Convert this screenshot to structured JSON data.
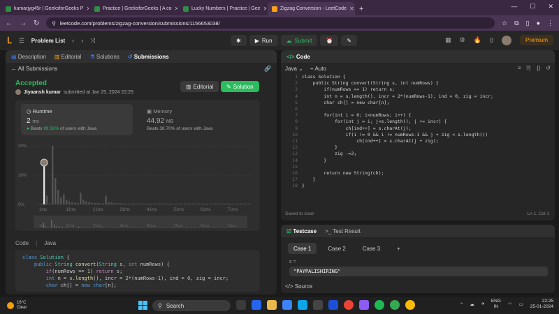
{
  "browser": {
    "tabs": [
      {
        "title": "kumarjyg45r | GeeksforGeeks P",
        "active": false
      },
      {
        "title": "Practice | GeeksforGeeks | A co",
        "active": false
      },
      {
        "title": "Lucky Numbers | Practice | Gee",
        "active": false
      },
      {
        "title": "Zigzag Conversion - LeetCode",
        "active": true
      }
    ],
    "url": "leetcode.com/problems/zigzag-conversion/submissions/1156653038/"
  },
  "header": {
    "problem_list": "Problem List",
    "run": "Run",
    "submit": "Submit",
    "coins": "0",
    "premium": "Premium"
  },
  "left_panel": {
    "tabs": [
      "Description",
      "Editorial",
      "Solutions",
      "Submissions"
    ],
    "back": "All Submissions",
    "status": "Accepted",
    "author": "Jiyaansh kumar",
    "submitted": "submitted at Jan 25, 2024 22:25",
    "editorial_btn": "Editorial",
    "solution_btn": "Solution",
    "runtime_label": "Runtime",
    "runtime_value": "2",
    "runtime_unit": "ms",
    "runtime_beats_prefix": "Beats",
    "runtime_beats": "99.58%",
    "runtime_beats_suffix": "of users with Java",
    "memory_label": "Memory",
    "memory_value": "44.92",
    "memory_unit": "MB",
    "memory_beats": "Beats 38.70% of users with Java",
    "code_label": "Code",
    "lang_label": "Java"
  },
  "chart_data": {
    "type": "bar",
    "y_ticks": [
      "20%",
      "10%",
      "0%"
    ],
    "ylim": [
      0,
      20
    ],
    "x_ticks": [
      "1ms",
      "11ms",
      "21ms",
      "31ms",
      "41ms",
      "51ms",
      "61ms",
      "71ms"
    ],
    "values": [
      0.3,
      13,
      3,
      0.4,
      20,
      9,
      5,
      2.5,
      3.5,
      1.5,
      1,
      0.7,
      0.6,
      0.5,
      4,
      1.5,
      1,
      0.8,
      0.6,
      0.5,
      0.5,
      0.4,
      0.4,
      3,
      0.8,
      0.6,
      0.5,
      0.4,
      0.4,
      0.3,
      0.3,
      0.3,
      0.3,
      0.3,
      0.3,
      0.3,
      0.3,
      0.3,
      0.3,
      0.3,
      0.3,
      0.3,
      0.3,
      0.3,
      0.3,
      0.3,
      0.3,
      0.3,
      0.3,
      0.3,
      0.3,
      0.3,
      0.3,
      0.3,
      0.3,
      0.3,
      0.3,
      0.3,
      0.3,
      0.3,
      0.3,
      0.3,
      0.3,
      0.3,
      0.3,
      0.3,
      0.3,
      0.3,
      0.3,
      0.3,
      0.3,
      0.3,
      0.3,
      0.3,
      0.3
    ],
    "highlight_index": 1
  },
  "code_panel": {
    "title": "Code",
    "language": "Java",
    "mode": "Auto",
    "saved": "Saved to local",
    "cursor": "Ln 1, Col 1",
    "lines": [
      "class Solution {",
      "    public String convert(String s, int numRows) {",
      "        if(numRows == 1) return s;",
      "        int n = s.length(), incr = 2*(numRows-1), ind = 0, zig = incr;",
      "        char ch[] = new char[n];",
      "",
      "        for(int i = 0; i<numRows; i++) {",
      "            for(int j = i; j<s.length(); j += incr) {",
      "                ch[ind++] = s.charAt(j);",
      "                if(i != 0 && i != numRows-1 && j + zig < s.length())",
      "                    ch[ind++] = s.charAt(j + zig);",
      "            }",
      "            zig -=2;",
      "        }",
      "",
      "        return new String(ch);",
      "    }",
      "}"
    ]
  },
  "testcase_panel": {
    "tab1": "Testcase",
    "tab2": "Test Result",
    "cases": [
      "Case 1",
      "Case 2",
      "Case 3"
    ],
    "var": "s =",
    "value": "\"PAYPALISHIRING\"",
    "source": "Source"
  },
  "taskbar": {
    "temp": "16°C",
    "weather": "Clear",
    "search": "Search",
    "lang1": "ENG",
    "lang2": "IN",
    "time": "22:25",
    "date": "25-01-2024"
  }
}
